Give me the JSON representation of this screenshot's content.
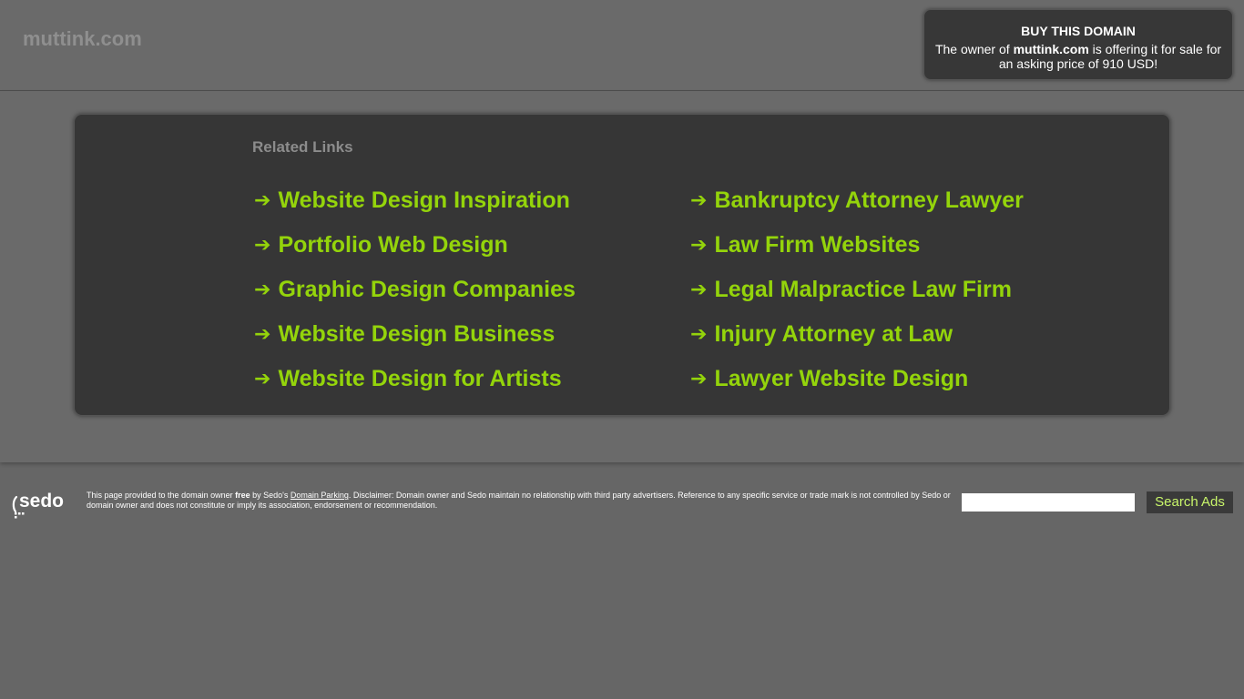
{
  "header": {
    "site_title": "muttink.com",
    "buy_box": {
      "title": "BUY THIS DOMAIN",
      "text_prefix": "The owner of ",
      "domain": "muttink.com",
      "text_suffix": " is offering it for sale for an asking price of 910 USD!"
    }
  },
  "related": {
    "title": "Related Links",
    "arrow": "➔",
    "left_links": [
      "Website Design Inspiration",
      "Portfolio Web Design",
      "Graphic Design Companies",
      "Website Design Business",
      "Website Design for Artists"
    ],
    "right_links": [
      "Bankruptcy Attorney Lawyer",
      "Law Firm Websites",
      "Legal Malpractice Law Firm",
      "Injury Attorney at Law",
      "Lawyer Website Design"
    ]
  },
  "footer": {
    "logo_text": "sedo",
    "disclaimer_1": "This page provided to the domain owner ",
    "disclaimer_free": "free",
    "disclaimer_2": " by Sedo's ",
    "disclaimer_link": "Domain Parking",
    "disclaimer_3": ". Disclaimer: Domain owner and Sedo maintain no relationship with third party advertisers. Reference to any specific service or trade mark is not controlled by Sedo or domain owner and does not constitute or imply its association, endorsement or recommendation.",
    "search_value": "",
    "search_button": "Search Ads"
  },
  "colors": {
    "background": "#666666",
    "panel": "#363636",
    "link": "#94d40b",
    "search_button_text": "#c8f56a"
  }
}
